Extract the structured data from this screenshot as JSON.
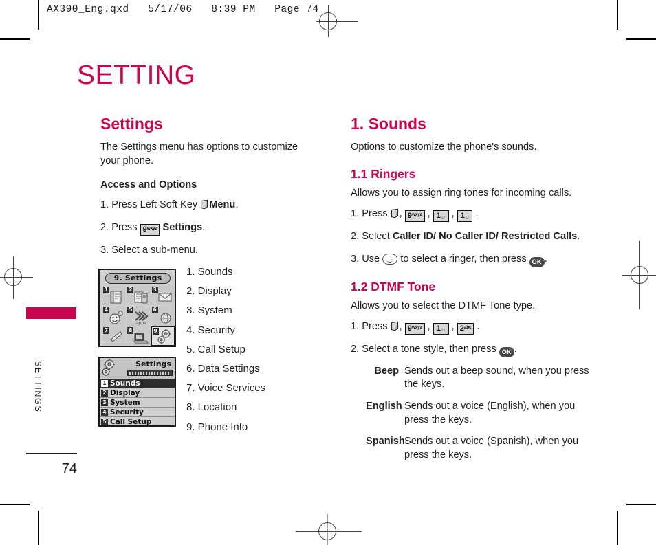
{
  "slug": "AX390_Eng.qxd   5/17/06   8:39 PM   Page 74",
  "chapter_title": "SETTING",
  "side_tab_label": "SETTINGS",
  "folio": "74",
  "accent_color": "#C8064F",
  "left_column": {
    "heading": "Settings",
    "intro": "The Settings menu has options to customize your phone.",
    "access_heading": "Access and Options",
    "steps": [
      {
        "prefix": "1. Press Left Soft Key ",
        "key": "soft",
        "suffix_bold": "Menu",
        "suffix": "."
      },
      {
        "prefix": "2. Press ",
        "key": "9wxyz",
        "suffix_bold": "Settings",
        "suffix": "."
      },
      {
        "prefix": "3. Select a sub-menu.",
        "key": "",
        "suffix_bold": "",
        "suffix": ""
      }
    ],
    "menu_items": [
      "1. Sounds",
      "2. Display",
      "3. System",
      "4. Security",
      "5. Call Setup",
      "6. Data Settings",
      "7. Voice Services",
      "8. Location",
      "9. Phone Info"
    ]
  },
  "phone_grid_screenshot": {
    "title": "9. Settings",
    "cells": [
      {
        "badge": "1",
        "icon": "contacts-icon",
        "selected": false
      },
      {
        "badge": "2",
        "icon": "messaging-icon",
        "selected": false
      },
      {
        "badge": "3",
        "icon": "envelope-icon",
        "selected": false
      },
      {
        "badge": "4",
        "icon": "emoji-icon",
        "selected": false
      },
      {
        "badge": "5",
        "icon": "apps-icon",
        "selected": false
      },
      {
        "badge": "6",
        "icon": "globe-icon",
        "selected": false
      },
      {
        "badge": "7",
        "icon": "music-icon",
        "selected": false
      },
      {
        "badge": "8",
        "icon": "media-icon",
        "selected": false
      },
      {
        "badge": "9",
        "icon": "gears-icon",
        "selected": true
      }
    ]
  },
  "phone_list_screenshot": {
    "title": "Settings",
    "rows": [
      {
        "num": "1",
        "label": "Sounds",
        "highlighted": true
      },
      {
        "num": "2",
        "label": "Display",
        "highlighted": false
      },
      {
        "num": "3",
        "label": "System",
        "highlighted": false
      },
      {
        "num": "4",
        "label": "Security",
        "highlighted": false
      },
      {
        "num": "5",
        "label": "Call Setup",
        "highlighted": false
      }
    ]
  },
  "right_column": {
    "heading": "1. Sounds",
    "intro": "Options to customize the phone's sounds.",
    "ringers": {
      "heading": "1.1 Ringers",
      "intro": "Allows you to assign ring tones for incoming calls.",
      "step1_prefix": "1. Press ",
      "step2_prefix": "2. Select ",
      "step2_bold": "Caller ID/ No Caller ID/ Restricted Calls",
      "step2_suffix": ".",
      "step3_prefix": "3. Use ",
      "step3_mid": " to select a ringer, then press ",
      "step3_suffix": "."
    },
    "dtmf": {
      "heading": "1.2 DTMF Tone",
      "intro": "Allows you to select the DTMF Tone type.",
      "step1_prefix": "1. Press ",
      "step2_prefix": "2. Select a tone style, then press ",
      "step2_suffix": ".",
      "definitions": [
        {
          "term": "Beep",
          "desc": "Sends out a beep sound, when you press the keys."
        },
        {
          "term": "English",
          "desc": "Sends out a voice (English), when you press the keys."
        },
        {
          "term": "Spanish",
          "desc": "Sends out a voice (Spanish), when you press the keys."
        }
      ]
    }
  },
  "keys": {
    "nine": "9",
    "nine_sup": "wxyz",
    "one": "1",
    "two": "2",
    "two_sup": "abc",
    "ok": "OK"
  }
}
